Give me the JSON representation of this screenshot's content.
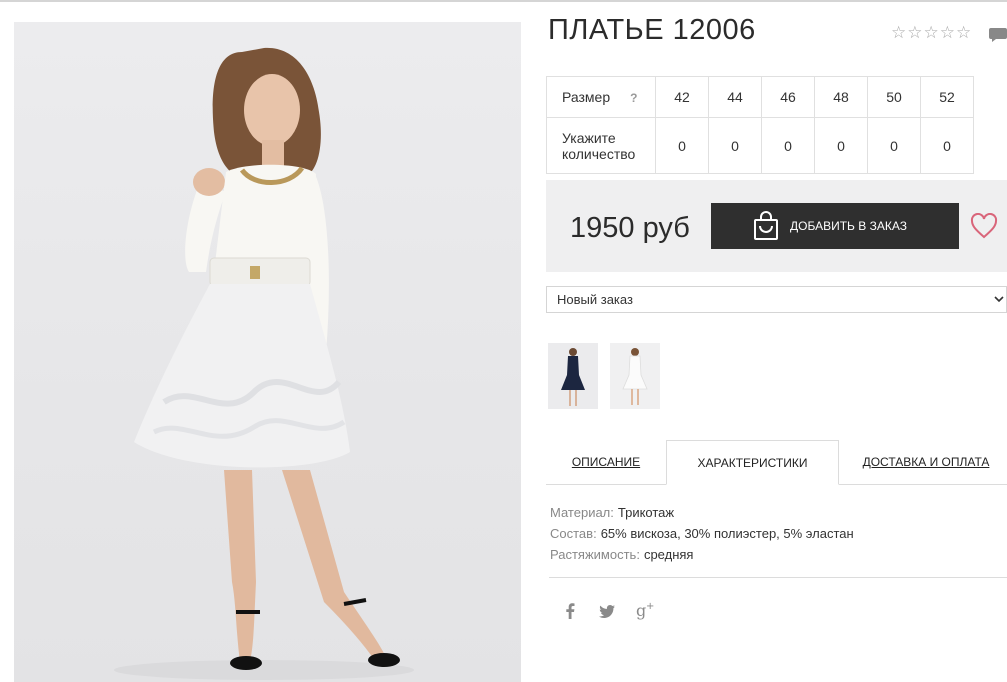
{
  "product": {
    "title": "ПЛАТЬЕ 12006",
    "rating": {
      "filled": 0,
      "max": 5
    }
  },
  "sizes": {
    "size_label": "Размер",
    "help_mark": "?",
    "qty_label_line1": "Укажите",
    "qty_label_line2": "количество",
    "values": [
      "42",
      "44",
      "46",
      "48",
      "50",
      "52"
    ],
    "quantities": [
      "0",
      "0",
      "0",
      "0",
      "0",
      "0"
    ]
  },
  "purchase": {
    "price": "1950 руб",
    "add_label": "ДОБАВИТЬ В ЗАКАЗ"
  },
  "order_select": {
    "selected": "Новый заказ"
  },
  "tabs": [
    {
      "label": "ОПИСАНИЕ",
      "active": false
    },
    {
      "label": "ХАРАКТЕРИСТИКИ",
      "active": true
    },
    {
      "label": "ДОСТАВКА И ОПЛАТА",
      "active": false
    }
  ],
  "specs": [
    {
      "key": "Материал:",
      "value": "Трикотаж"
    },
    {
      "key": "Состав:",
      "value": "65% вискоза, 30% полиэстер, 5% эластан"
    },
    {
      "key": "Растяжимость:",
      "value": "средняя"
    }
  ],
  "social": [
    "facebook-icon",
    "twitter-icon",
    "google-plus-icon"
  ],
  "colors": {
    "button": "#2f2f2f",
    "heart": "#d9657a",
    "panel": "#efeff0"
  }
}
